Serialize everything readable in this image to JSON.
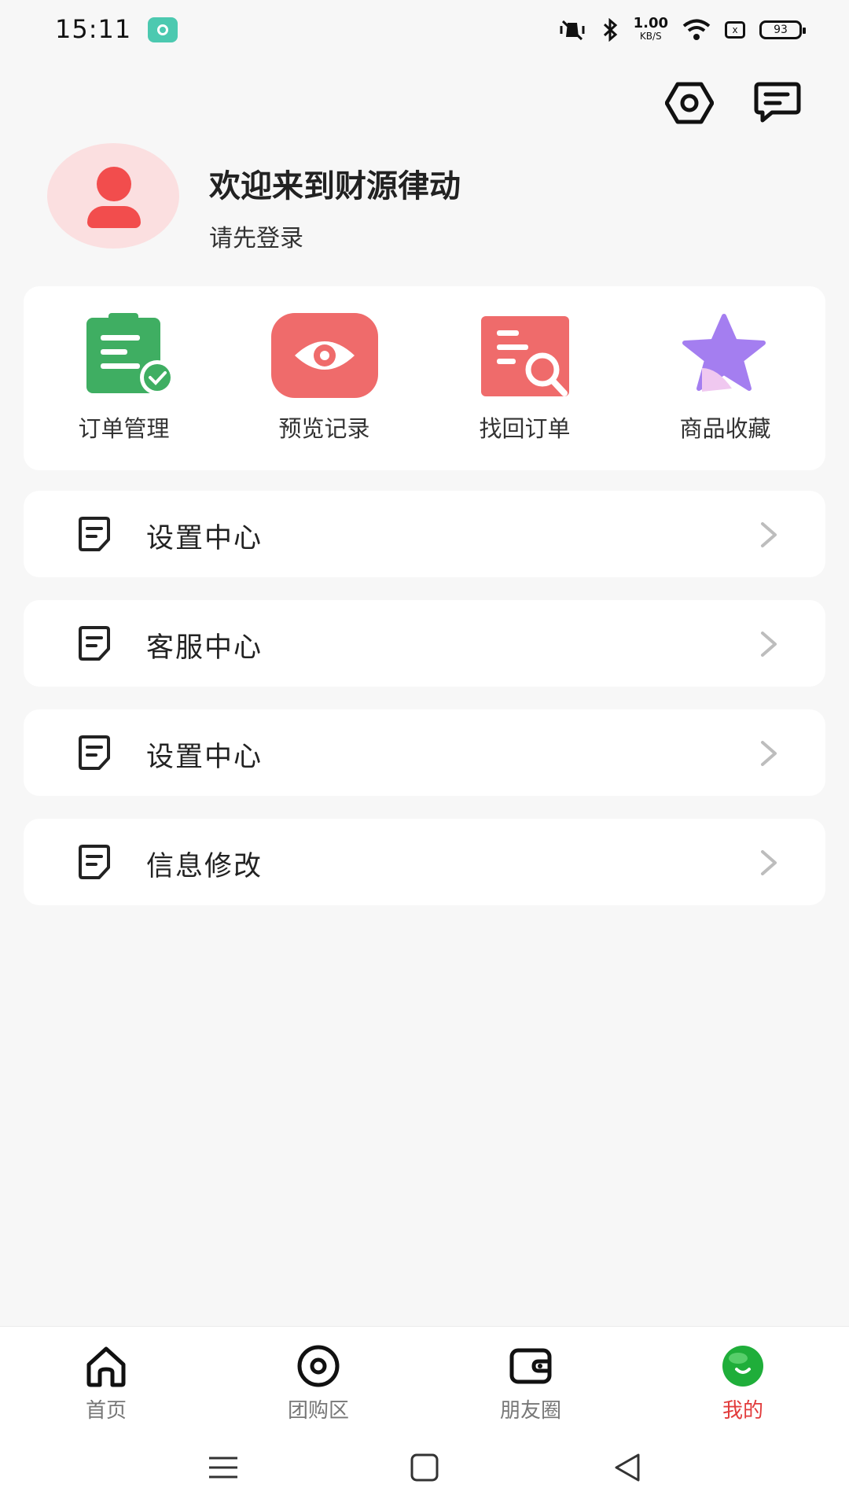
{
  "status_bar": {
    "time": "15:11",
    "speed_value": "1.00",
    "speed_unit": "KB/S",
    "sim_label": "x",
    "battery": "93"
  },
  "top_icons": {
    "settings_icon": "hexagon-gear-icon",
    "message_icon": "chat-bubble-icon"
  },
  "profile": {
    "welcome": "欢迎来到财源律动",
    "login_prompt": "请先登录"
  },
  "shortcuts": [
    {
      "label": "订单管理",
      "icon": "clipboard-check-icon",
      "color": "#3fae62"
    },
    {
      "label": "预览记录",
      "icon": "eye-icon",
      "color": "#ef6b6b"
    },
    {
      "label": "找回订单",
      "icon": "document-search-icon",
      "color": "#ef6b6b"
    },
    {
      "label": "商品收藏",
      "icon": "star-icon",
      "color": "#a47ef0"
    }
  ],
  "menu_items": [
    {
      "label": "设置中心"
    },
    {
      "label": "客服中心"
    },
    {
      "label": "设置中心"
    },
    {
      "label": "信息修改"
    }
  ],
  "bottom_nav": [
    {
      "label": "首页",
      "icon": "home-icon"
    },
    {
      "label": "团购区",
      "icon": "target-icon"
    },
    {
      "label": "朋友圈",
      "icon": "wallet-icon"
    },
    {
      "label": "我的",
      "icon": "smile-ball-icon",
      "active": true
    }
  ],
  "colors": {
    "accent": "#e23b3b",
    "background": "#f7f7f7",
    "avatar_bg": "#fbdfe0"
  }
}
